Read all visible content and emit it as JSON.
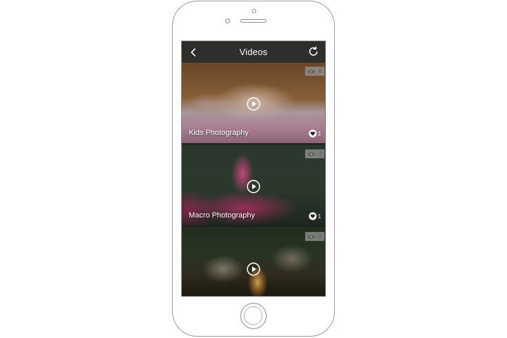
{
  "header": {
    "title": "Videos",
    "back_icon": "chevron-left-icon",
    "refresh_icon": "refresh-icon"
  },
  "videos": [
    {
      "title": "Kids Photography",
      "views": "6",
      "likes": "1",
      "scene": "child under fur blanket on pink bedding"
    },
    {
      "title": "Macro Photography",
      "views": "2",
      "likes": "1",
      "scene": "pink flower petal with water drops"
    },
    {
      "title": "",
      "views": "1",
      "likes": "",
      "scene": "people gathered around a campfire at night"
    }
  ],
  "colors": {
    "appbar": "#2c2f29",
    "text": "#ffffff",
    "badge": "#969696"
  }
}
